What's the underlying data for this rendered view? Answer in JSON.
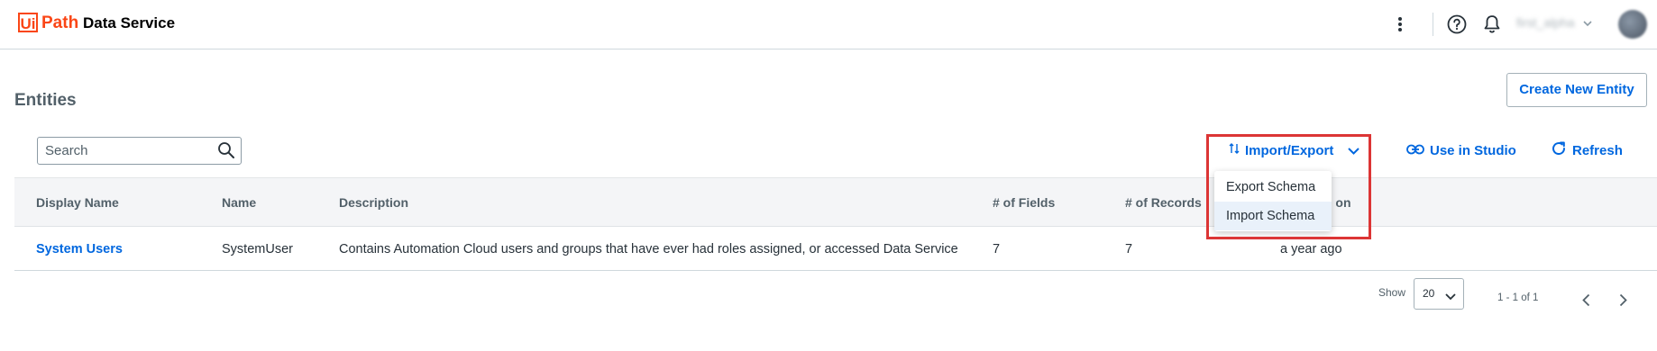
{
  "header": {
    "logo_ui": "Ui",
    "logo_path": "Path",
    "app_name": "Data Service",
    "user_name": "first_alpha"
  },
  "page": {
    "title": "Entities",
    "create_button": "Create New Entity"
  },
  "search": {
    "placeholder": "Search",
    "value": ""
  },
  "toolbar": {
    "import_export": "Import/Export",
    "use_in_studio": "Use in Studio",
    "refresh": "Refresh"
  },
  "dropdown": {
    "items": [
      {
        "label": "Export Schema"
      },
      {
        "label": "Import Schema"
      }
    ]
  },
  "table": {
    "columns": [
      "Display Name",
      "Name",
      "Description",
      "# of Fields",
      "# of Records",
      "Modified on"
    ],
    "rows": [
      {
        "display_name": "System Users",
        "name": "SystemUser",
        "description": "Contains Automation Cloud users and groups that have ever had roles assigned, or accessed Data Service",
        "fields": "7",
        "records": "7",
        "modified": "a year ago"
      }
    ]
  },
  "pagination": {
    "show_label": "Show",
    "page_size": "20",
    "range": "1 - 1 of 1"
  },
  "colors": {
    "accent": "#0067df",
    "brand": "#fa4616",
    "highlight": "#dc3535"
  }
}
